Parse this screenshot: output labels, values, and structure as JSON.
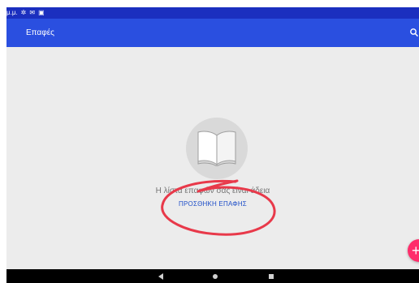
{
  "statusbar": {
    "time": "μ.μ.",
    "icons": [
      "gear-icon",
      "mail-icon",
      "image-icon"
    ]
  },
  "appbar": {
    "title": "Επαφές",
    "search_icon": "search-icon"
  },
  "empty_state": {
    "icon": "book-icon",
    "message": "Η λίστα επαφών σας είναι άδεια",
    "add_contact_label": "ΠΡΟΣΘΗΚΗ ΕΠΑΦΗΣ"
  },
  "fab": {
    "icon": "plus-icon"
  },
  "navbar": {
    "buttons": [
      "back-icon",
      "home-icon",
      "recents-icon"
    ]
  },
  "colors": {
    "statusbar": "#1b2fbf",
    "appbar": "#2a4fe0",
    "background": "#ececec",
    "link": "#1f4fc8",
    "fab": "#ff2d6b",
    "annotation": "#e8394a"
  }
}
